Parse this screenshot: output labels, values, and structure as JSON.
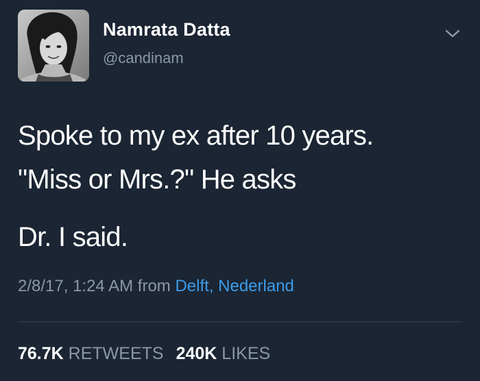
{
  "user": {
    "display_name": "Namrata Datta",
    "handle": "@candinam",
    "avatar_icon": "profile-photo"
  },
  "tweet": {
    "lines": [
      "Spoke to my ex after 10 years.",
      "\"Miss or Mrs.?\" He asks",
      "Dr. I said."
    ],
    "timestamp": "2/8/17, 1:24 AM",
    "from_label": "from",
    "location": "Delft, Nederland"
  },
  "stats": {
    "retweets_count": "76.7K",
    "retweets_label": "RETWEETS",
    "likes_count": "240K",
    "likes_label": "LIKES"
  },
  "colors": {
    "background": "#1b2533",
    "text_primary": "#ffffff",
    "text_secondary": "#8b98a5",
    "link": "#3d9be9",
    "divider": "#38444d"
  },
  "icons": {
    "menu": "chevron-down-icon"
  }
}
